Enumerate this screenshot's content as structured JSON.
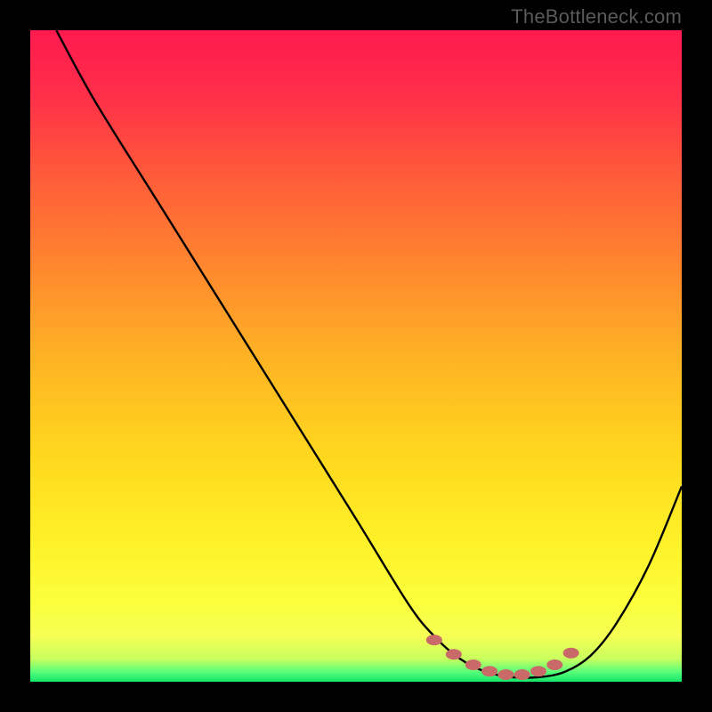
{
  "attribution": "TheBottleneck.com",
  "gradient_stops": [
    {
      "offset": 0.0,
      "color": "#ff1a4f"
    },
    {
      "offset": 0.1,
      "color": "#ff2f49"
    },
    {
      "offset": 0.22,
      "color": "#ff5a3a"
    },
    {
      "offset": 0.35,
      "color": "#ff8330"
    },
    {
      "offset": 0.5,
      "color": "#ffb224"
    },
    {
      "offset": 0.65,
      "color": "#ffd71e"
    },
    {
      "offset": 0.78,
      "color": "#fff028"
    },
    {
      "offset": 0.88,
      "color": "#fbff3c"
    },
    {
      "offset": 0.93,
      "color": "#f6ff55"
    },
    {
      "offset": 0.965,
      "color": "#c8ff5e"
    },
    {
      "offset": 0.985,
      "color": "#58ff7a"
    },
    {
      "offset": 1.0,
      "color": "#14e56a"
    }
  ],
  "chart_data": {
    "type": "line",
    "title": "",
    "xlabel": "",
    "ylabel": "",
    "xlim": [
      0,
      100
    ],
    "ylim": [
      0,
      100
    ],
    "grid": false,
    "legend": false,
    "series": [
      {
        "name": "bottleneck-curve",
        "x": [
          4,
          10,
          20,
          30,
          40,
          50,
          58,
          62,
          66,
          70,
          74,
          78,
          82,
          86,
          90,
          95,
          100
        ],
        "y": [
          100,
          89,
          73,
          57,
          41,
          25,
          12,
          7,
          3.5,
          1.5,
          0.7,
          0.7,
          1.5,
          4,
          9,
          18,
          30
        ]
      }
    ],
    "markers": {
      "name": "highlight-dots",
      "color": "#c96a68",
      "x": [
        62,
        65,
        68,
        70.5,
        73,
        75.5,
        78,
        80.5,
        83
      ],
      "y": [
        6.4,
        4.2,
        2.6,
        1.6,
        1.1,
        1.1,
        1.6,
        2.6,
        4.4
      ]
    }
  }
}
